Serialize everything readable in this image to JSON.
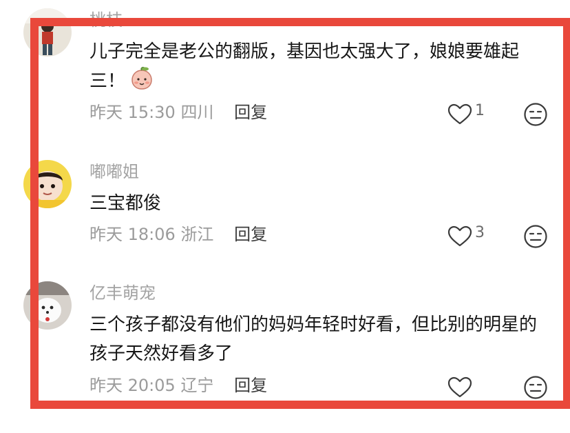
{
  "comments": [
    {
      "username": "桃枝",
      "text": "儿子完全是老公的翻版，基因也太强大了，娘娘要雄起三！",
      "emoji": "peach-face-emoji",
      "time": "昨天 15:30",
      "location": "四川",
      "reply_label": "回复",
      "likes": "1"
    },
    {
      "username": "嘟嘟姐",
      "text": "三宝都俊",
      "time": "昨天 18:06",
      "location": "浙江",
      "reply_label": "回复",
      "likes": "3"
    },
    {
      "username": "亿丰萌宠",
      "text": "三个孩子都没有他们的妈妈年轻时好看，但比别的明星的孩子天然好看多了",
      "time": "昨天 20:05",
      "location": "辽宁",
      "reply_label": "回复",
      "likes": ""
    }
  ],
  "icons": {
    "like": "heart-outline-icon",
    "dislike": "meh-face-icon"
  },
  "colors": {
    "frame": "#e9483b",
    "username": "#a3a3a3",
    "meta": "#9b9b9b",
    "text": "#161616"
  }
}
